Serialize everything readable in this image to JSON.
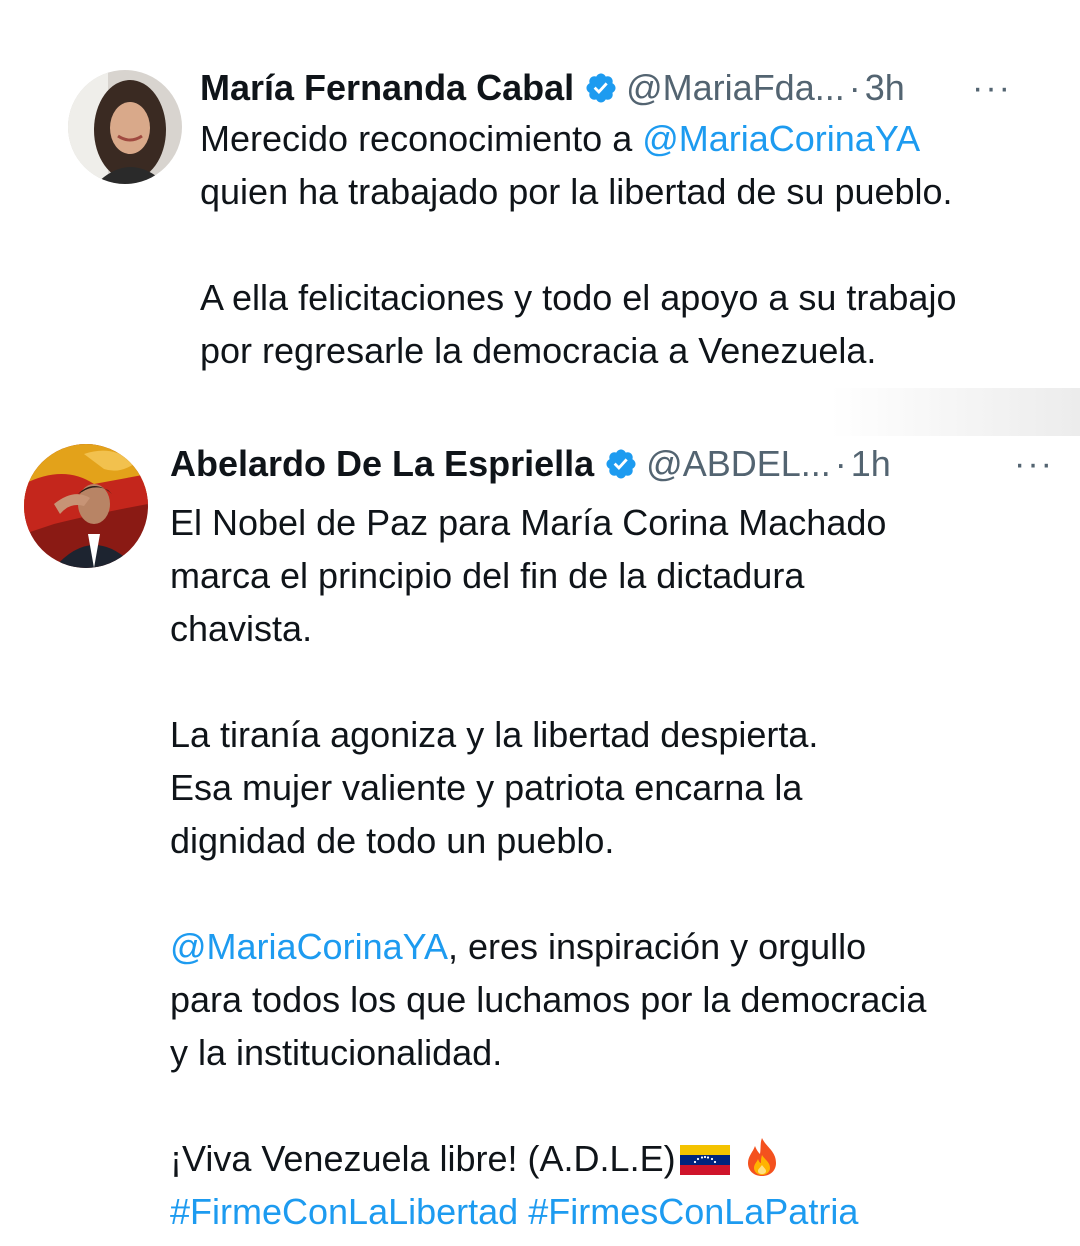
{
  "tweets": [
    {
      "author": "María Fernanda Cabal",
      "handle": "@MariaFda...",
      "separator": "·",
      "time": "3h",
      "more": "···",
      "text": {
        "p1_a": "Merecido reconocimiento a ",
        "p1_link": "@MariaCorinaYA",
        "p1_b": "quien ha trabajado por la libertad de su pueblo.",
        "p2_a": "A ella felicitaciones y todo el apoyo a su trabajo",
        "p2_b": "por regresarle la democracia a Venezuela."
      }
    },
    {
      "author": "Abelardo De La Espriella",
      "handle": "@ABDEL...",
      "separator": "·",
      "time": "1h",
      "more": "···",
      "text": {
        "l1": "El Nobel de Paz para María Corina Machado",
        "l2": "marca el principio del fin de la dictadura",
        "l3": "chavista.",
        "l4": "La tiranía agoniza y la libertad despierta.",
        "l5": "Esa mujer valiente y patriota encarna la",
        "l6": "dignidad de todo un pueblo.",
        "l7_link": "@MariaCorinaYA",
        "l7_b": ", eres inspiración y orgullo",
        "l8": "para todos los que luchamos por la democracia",
        "l9": "y la institucionalidad.",
        "l10": "¡Viva Venezuela libre! (A.D.L.E)",
        "hashtag1": "#FirmeConLaLibertad",
        "hashtag2": "#FirmesConLaPatria"
      }
    }
  ],
  "icons": [
    "verified-badge-icon",
    "more-options-icon",
    "venezuela-flag-icon",
    "fire-icon"
  ],
  "colors": {
    "link": "#1d9bf0",
    "secondary": "#536471",
    "text": "#0f1419",
    "verified": "#1d9bf0"
  }
}
